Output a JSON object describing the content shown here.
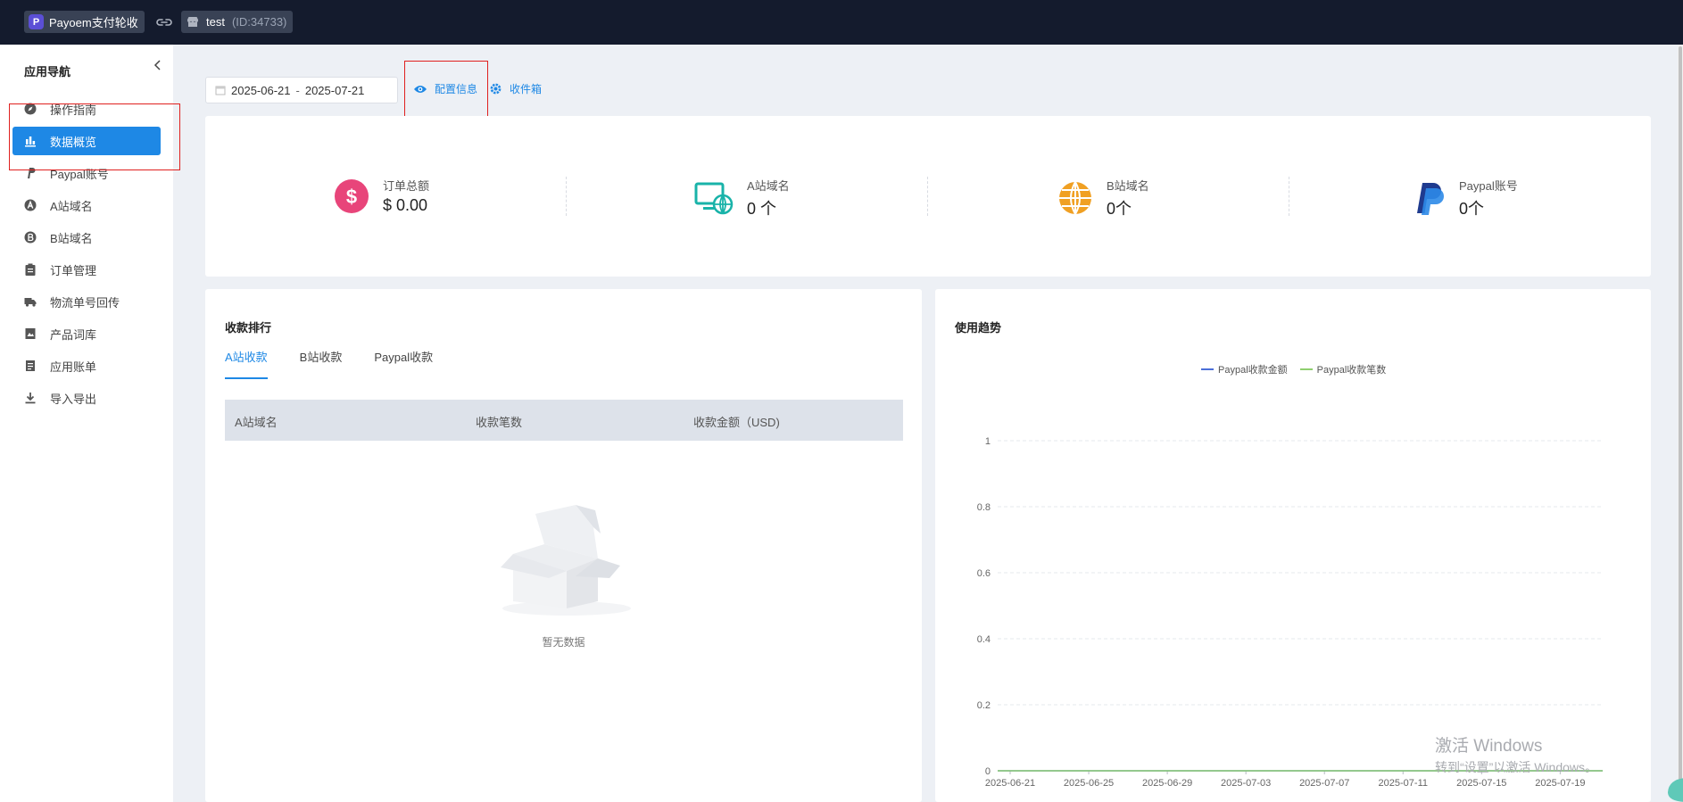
{
  "topbar": {
    "app_name": "Payoem支付轮收",
    "logo_letter": "P",
    "store_name": "test",
    "store_id": "(ID:34733)"
  },
  "sidebar": {
    "title": "应用导航",
    "items": [
      {
        "label": "操作指南",
        "icon": "compass-icon"
      },
      {
        "label": "数据概览",
        "icon": "bar-chart-icon",
        "active": true
      },
      {
        "label": "Paypal账号",
        "icon": "paypal-icon"
      },
      {
        "label": "A站域名",
        "icon": "circle-a-icon"
      },
      {
        "label": "B站域名",
        "icon": "circle-b-icon"
      },
      {
        "label": "订单管理",
        "icon": "clipboard-icon"
      },
      {
        "label": "物流单号回传",
        "icon": "truck-icon"
      },
      {
        "label": "产品词库",
        "icon": "image-book-icon"
      },
      {
        "label": "应用账单",
        "icon": "bill-icon"
      },
      {
        "label": "导入导出",
        "icon": "download-icon"
      }
    ]
  },
  "toolbar": {
    "date_start": "2025-06-21",
    "date_sep": "-",
    "date_end": "2025-07-21",
    "config_label": "配置信息",
    "inbox_label": "收件箱"
  },
  "stats": [
    {
      "label": "订单总额",
      "value": "$ 0.00",
      "icon": "dollar-circle-icon",
      "color": "#e8457a"
    },
    {
      "label": "A站域名",
      "value": "0 个",
      "icon": "monitor-globe-icon",
      "color": "#19b3a9"
    },
    {
      "label": "B站域名",
      "value": "0个",
      "icon": "globe-icon",
      "color": "#f0a023"
    },
    {
      "label": "Paypal账号",
      "value": "0个",
      "icon": "paypal-logo-icon",
      "color": "#2c6ed8"
    }
  ],
  "ranking": {
    "title": "收款排行",
    "tabs": [
      "A站收款",
      "B站收款",
      "Paypal收款"
    ],
    "columns": [
      "A站域名",
      "收款笔数",
      "收款金额（USD)"
    ],
    "empty_text": "暂无数据"
  },
  "trend": {
    "title": "使用趋势"
  },
  "chart_data": {
    "type": "line",
    "x": [
      "2025-06-21",
      "2025-06-25",
      "2025-06-29",
      "2025-07-03",
      "2025-07-07",
      "2025-07-11",
      "2025-07-15",
      "2025-07-19"
    ],
    "series": [
      {
        "name": "Paypal收款金额",
        "color": "#4c6fd8",
        "values": [
          0,
          0,
          0,
          0,
          0,
          0,
          0,
          0
        ]
      },
      {
        "name": "Paypal收款笔数",
        "color": "#8fcf6f",
        "values": [
          0,
          0,
          0,
          0,
          0,
          0,
          0,
          0
        ]
      }
    ],
    "yticks": [
      "0",
      "0.2",
      "0.4",
      "0.6",
      "0.8",
      "1"
    ],
    "ylim": [
      0,
      1
    ],
    "grid": true,
    "legend": "top-center"
  },
  "watermark": {
    "line1": "激活 Windows",
    "line2": "转到“设置”以激活 Windows。"
  }
}
